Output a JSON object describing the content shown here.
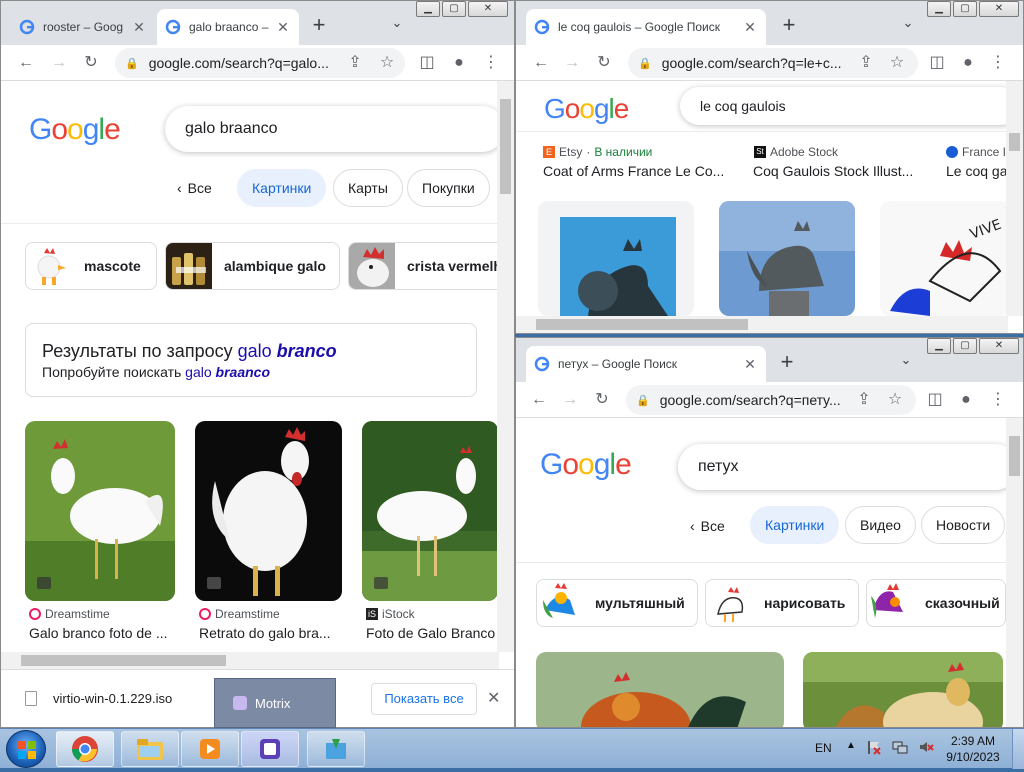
{
  "colors": {
    "google_blue": "#4285f4",
    "google_red": "#ea4335",
    "google_yellow": "#fbbc05",
    "google_green": "#34a853",
    "chip_selected": "#e8f0fe",
    "link_purple": "#1a0dab"
  },
  "window_left": {
    "tabs": [
      {
        "title": "rooster – Goog",
        "icon": "google-g-icon"
      },
      {
        "title": "galo braanco –",
        "icon": "google-g-icon",
        "active": true
      }
    ],
    "url": "google.com/search?q=galo...",
    "logo": "Google",
    "search_query": "galo braanco",
    "back_label": "Все",
    "filter_chips": [
      "Картинки",
      "Карты",
      "Покупки"
    ],
    "suggestions": [
      "mascote",
      "alambique galo",
      "crista vermelh"
    ],
    "correction": {
      "prefix": "Результаты по запросу",
      "term_plain": "galo",
      "term_bold": "branco",
      "try_prefix": "Попробуйте поискать",
      "try_plain": "galo",
      "try_bold": "braanco"
    },
    "results": [
      {
        "source": "Dreamstime",
        "caption": "Galo branco foto de ..."
      },
      {
        "source": "Dreamstime",
        "caption": "Retrato do galo bra..."
      },
      {
        "source": "iStock",
        "caption": "Foto de Galo Branco ..."
      }
    ],
    "download": {
      "filename": "virtio-win-0.1.229.iso",
      "show_all": "Показать все"
    },
    "motrix_label": "Motrix"
  },
  "window_top_right": {
    "tabs": [
      {
        "title": "le coq gaulois – Google Поиск",
        "icon": "google-g-icon",
        "active": true
      }
    ],
    "url": "google.com/search?q=le+c...",
    "logo": "Google",
    "search_query": "le coq gaulois",
    "results": [
      {
        "source": "Etsy",
        "badge": "В наличии",
        "caption": "Coat of Arms France Le Co..."
      },
      {
        "source": "Adobe Stock",
        "caption": "Coq Gaulois Stock Illust..."
      },
      {
        "source": "France I",
        "caption": "Le coq ga"
      }
    ]
  },
  "window_bottom_right": {
    "tabs": [
      {
        "title": "петух – Google Поиск",
        "icon": "google-g-icon",
        "active": true
      }
    ],
    "url": "google.com/search?q=петy...",
    "logo": "Google",
    "search_query": "петух",
    "back_label": "Все",
    "filter_chips": [
      "Картинки",
      "Видео",
      "Новости"
    ],
    "suggestions": [
      "мультяшный",
      "нарисовать",
      "сказочный"
    ]
  },
  "taskbar": {
    "lang": "EN",
    "time": "2:39 AM",
    "date": "9/10/2023"
  }
}
